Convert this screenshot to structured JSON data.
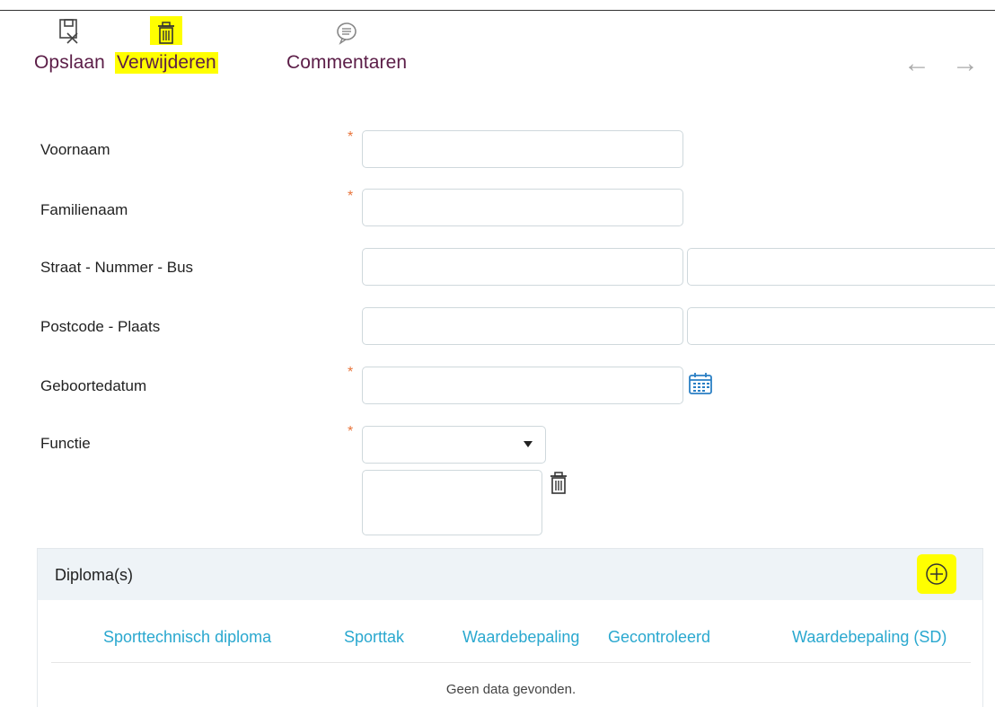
{
  "toolbar": {
    "save_label": "Opslaan",
    "delete_label": "Verwijderen",
    "comments_label": "Commentaren"
  },
  "nav": {
    "back": "←",
    "forward": "→"
  },
  "form": {
    "first_name_label": "Voornaam",
    "last_name_label": "Familienaam",
    "street_label": "Straat - Nummer - Bus",
    "postal_label": "Postcode - Plaats",
    "birthdate_label": "Geboortedatum",
    "function_label": "Functie",
    "required_mark": "*"
  },
  "diplomas": {
    "title": "Diploma(s)",
    "columns": [
      "Sporttechnisch diploma",
      "Sporttak",
      "Waardebepaling",
      "Gecontroleerd",
      "Waardebepaling (SD)"
    ],
    "empty_text": "Geen data gevonden."
  },
  "colors": {
    "toolbar_text": "#5b1d47",
    "highlight": "#ffff00",
    "column_header": "#2aa8cf",
    "required": "#e8743b",
    "calendar": "#2a7fc4"
  },
  "icons": [
    "save-icon",
    "trash-icon",
    "comment-icon",
    "arrow-left-icon",
    "arrow-right-icon",
    "calendar-icon",
    "plus-circle-icon"
  ]
}
